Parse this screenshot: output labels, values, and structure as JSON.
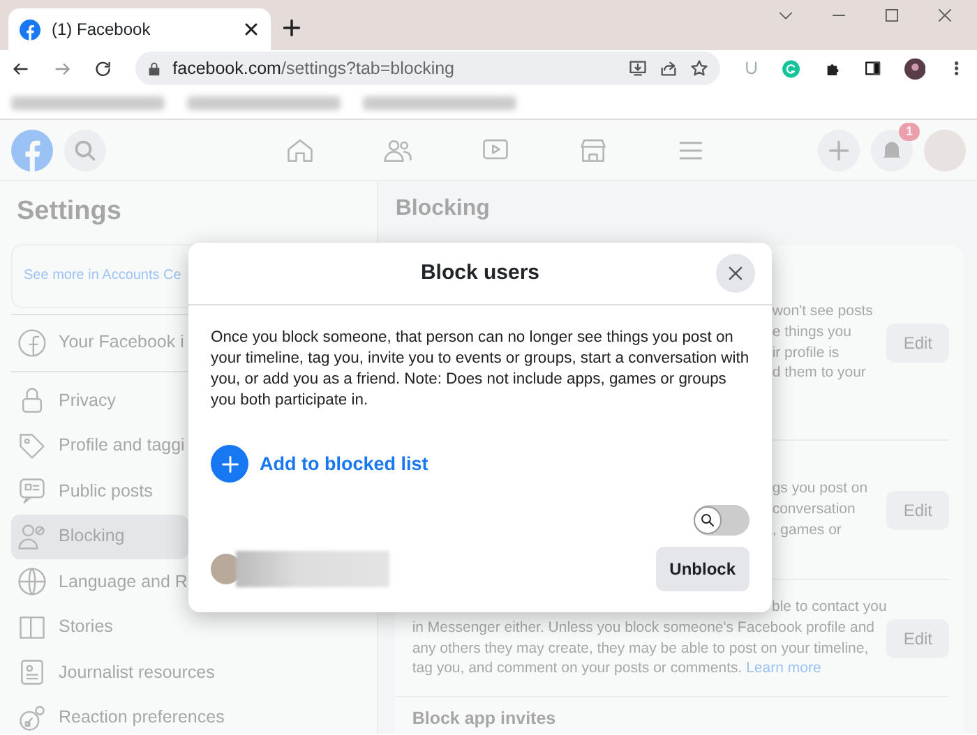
{
  "browser": {
    "tab_title": "(1) Facebook",
    "url_host": "facebook.com",
    "url_path": "/settings?tab=blocking"
  },
  "header": {
    "notification_count": "1"
  },
  "sidebar": {
    "title": "Settings",
    "accounts_link": "See more in Accounts Ce",
    "items": [
      {
        "label": "Your Facebook i",
        "selected": false
      },
      {
        "label": "Privacy",
        "selected": false
      },
      {
        "label": "Profile and taggi",
        "selected": false
      },
      {
        "label": "Public posts",
        "selected": false
      },
      {
        "label": "Blocking",
        "selected": true
      },
      {
        "label": "Language and R",
        "selected": false
      },
      {
        "label": "Stories",
        "selected": false
      },
      {
        "label": "Journalist resources",
        "selected": false
      },
      {
        "label": "Reaction preferences",
        "selected": false
      }
    ]
  },
  "main": {
    "title": "Blocking",
    "sections": [
      {
        "fragments": [
          "won't see posts",
          "e things you",
          "ir profile is",
          "d them to your"
        ],
        "edit": "Edit"
      },
      {
        "fragments": [
          "gs you post on",
          "conversation",
          ", games or"
        ],
        "edit": "Edit"
      },
      {
        "fragments": [
          "ble to contact you"
        ],
        "text": "in Messenger either. Unless you block someone's Facebook profile and any others they may create, they may be able to post on your timeline, tag you, and comment on your posts or comments.",
        "link": "Learn more",
        "edit": "Edit"
      },
      {
        "heading": "Block app invites"
      }
    ]
  },
  "dialog": {
    "title": "Block users",
    "body": "Once you block someone, that person can no longer see things you post on your timeline, tag you, invite you to events or groups, start a conversation with you, or add you as a friend. Note: Does not include apps, games or groups you both participate in.",
    "add_label": "Add to blocked list",
    "toggle": {
      "on": false
    },
    "users": [
      {
        "action": "Unblock"
      }
    ]
  }
}
